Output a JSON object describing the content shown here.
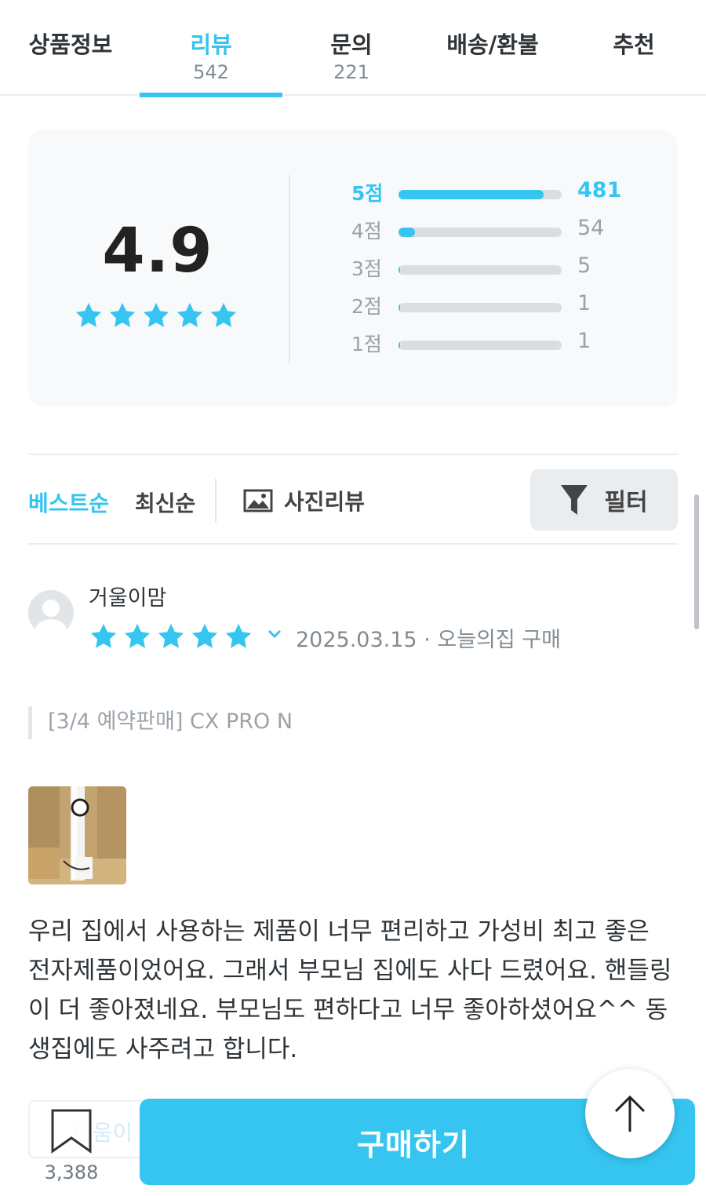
{
  "tabs": [
    {
      "label": "상품정보",
      "count": ""
    },
    {
      "label": "리뷰",
      "count": "542"
    },
    {
      "label": "문의",
      "count": "221"
    },
    {
      "label": "배송/환불",
      "count": ""
    },
    {
      "label": "추천",
      "count": ""
    }
  ],
  "active_tab": "리뷰",
  "summary": {
    "average": "4.9",
    "average_stars": 5,
    "distribution": [
      {
        "label": "5점",
        "count": "481",
        "fraction": 0.89
      },
      {
        "label": "4점",
        "count": "54",
        "fraction": 0.1
      },
      {
        "label": "3점",
        "count": "5",
        "fraction": 0.01
      },
      {
        "label": "2점",
        "count": "1",
        "fraction": 0.002
      },
      {
        "label": "1점",
        "count": "1",
        "fraction": 0.002
      }
    ]
  },
  "sort": {
    "best": "베스트순",
    "latest": "최신순",
    "photo_review": "사진리뷰",
    "filter": "필터"
  },
  "review": {
    "username": "거울이맘",
    "rating": 5,
    "date": "2025.03.15",
    "separator": "·",
    "source": "오늘의집 구매",
    "option": "[3/4 예약판매] CX PRO N",
    "text": "우리 집에서 사용하는 제품이 너무 편리하고 가성비 최고 좋은 전자제품이었어요. 그래서 부모님 집에도 사다 드렸어요. 핸들링이 더 좋아졌네요. 부모님도 편하다고 너무 좋아하셨어요^^ 동생집에도 사주려고 합니다."
  },
  "bottom": {
    "helpful_label": "도움이",
    "bookmark_count": "3,388",
    "buy_label": "구매하기"
  },
  "colors": {
    "accent": "#35c5f0",
    "text": "#2f3438",
    "muted": "#828c94",
    "card_bg": "#f7f9fa"
  },
  "icons": {
    "star": "star-icon",
    "photo": "image-icon",
    "filter": "funnel-icon",
    "bookmark": "bookmark-icon",
    "top": "arrow-up-icon",
    "expand": "chevron-down-icon"
  }
}
